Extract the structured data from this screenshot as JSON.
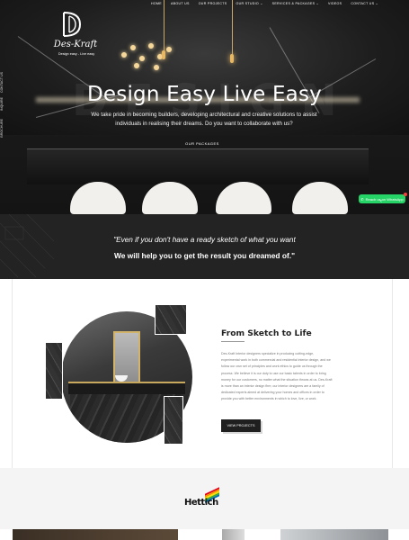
{
  "nav": {
    "items": [
      {
        "label": "HOME"
      },
      {
        "label": "ABOUT US"
      },
      {
        "label": "OUR PROJECTS"
      },
      {
        "label": "OUR STUDIO ⌄"
      },
      {
        "label": "SERVICES & PACKAGES ⌄"
      },
      {
        "label": "VIDEOS"
      },
      {
        "label": "CONTACT US ⌄"
      }
    ]
  },
  "logo": {
    "name": "Des-Kraft",
    "tagline": "Design easy - Live easy"
  },
  "side_labels": [
    "CONTACT US",
    "INQUIRE",
    "BROCHURE"
  ],
  "hero": {
    "watermark": "DESIGN",
    "title": "Design Easy Live Easy",
    "subtitle": "We take pride in becoming builders, developing architectural and creative solutions to assist individuals in realising their dreams. Do you want to collaborate with us?",
    "button_label": "OUR PACKAGES"
  },
  "whatsapp": {
    "label": "Reach us on WhatsApp"
  },
  "quote": {
    "line1": "\"Even if you don't have a ready sketch of what you want",
    "line2": "We will help you to get the result you dreamed of.\""
  },
  "sketch": {
    "title": "From Sketch to Life",
    "body": "Des-Kraft Interior designers specialize in producing cutting-edge, experimental work in both commercial and residential interior design, and we follow our own set of principles and work ethics to guide us through the process. We believe it is our duty to use our basic talents in order to bring money for our customers, no matter what the situation throws at us. Des-Kraft is more than an interior design firm; our interior designers are a family of dedicated experts aimed at delivering your homes and offices in order to provide you with better environments in which to love, live, or work.",
    "button_label": "VIEW PROJECTS"
  },
  "brand": {
    "name": "Hettich",
    "stripe_colors": [
      "#e2001a",
      "#f39200",
      "#ffde00",
      "#3aaa35",
      "#0069b4"
    ]
  }
}
